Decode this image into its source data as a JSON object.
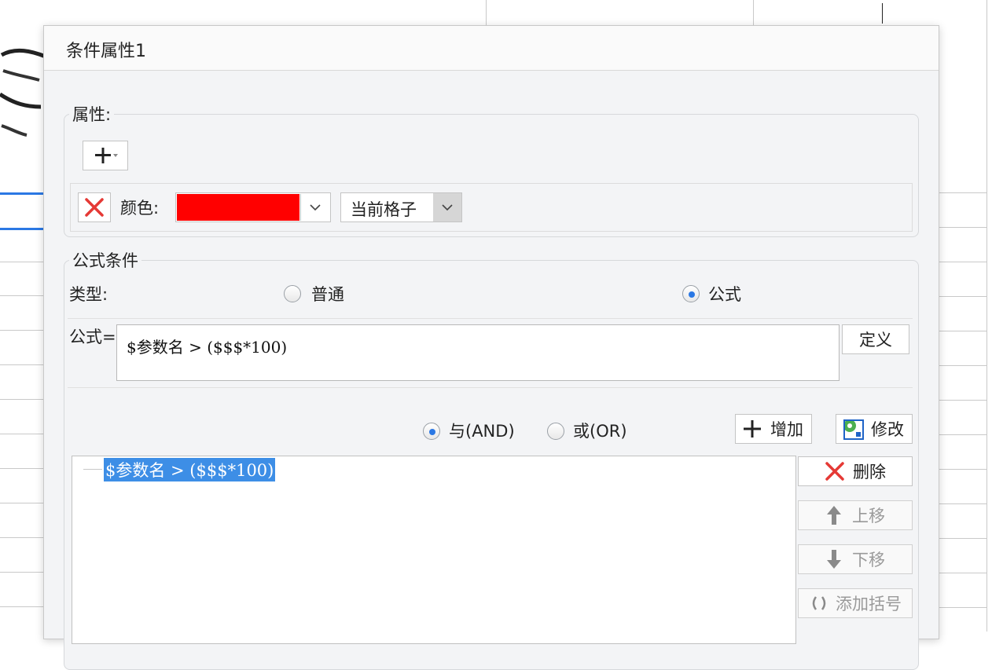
{
  "dialog": {
    "title": "条件属性1"
  },
  "properties": {
    "legend": "属性:",
    "add_button_glyph": "+▾",
    "color_label": "颜色:",
    "color_value": "#ff0000",
    "scope_value": "当前格子"
  },
  "formula_condition": {
    "legend": "公式条件",
    "type_label": "类型:",
    "type_options": [
      {
        "label": "普通",
        "checked": false
      },
      {
        "label": "公式",
        "checked": true
      }
    ],
    "formula_label": "公式=",
    "formula_value": "$参数名 > ($$$*100)",
    "define_button": "定义"
  },
  "logic": {
    "options": [
      {
        "label": "与(AND)",
        "checked": true
      },
      {
        "label": "或(OR)",
        "checked": false
      }
    ],
    "add_button": "增加",
    "modify_button": "修改"
  },
  "condition_list": {
    "items": [
      "$参数名 > ($$$*100)"
    ]
  },
  "side_buttons": {
    "delete": "删除",
    "move_up": "上移",
    "move_down": "下移",
    "add_brackets": "添加括号"
  }
}
